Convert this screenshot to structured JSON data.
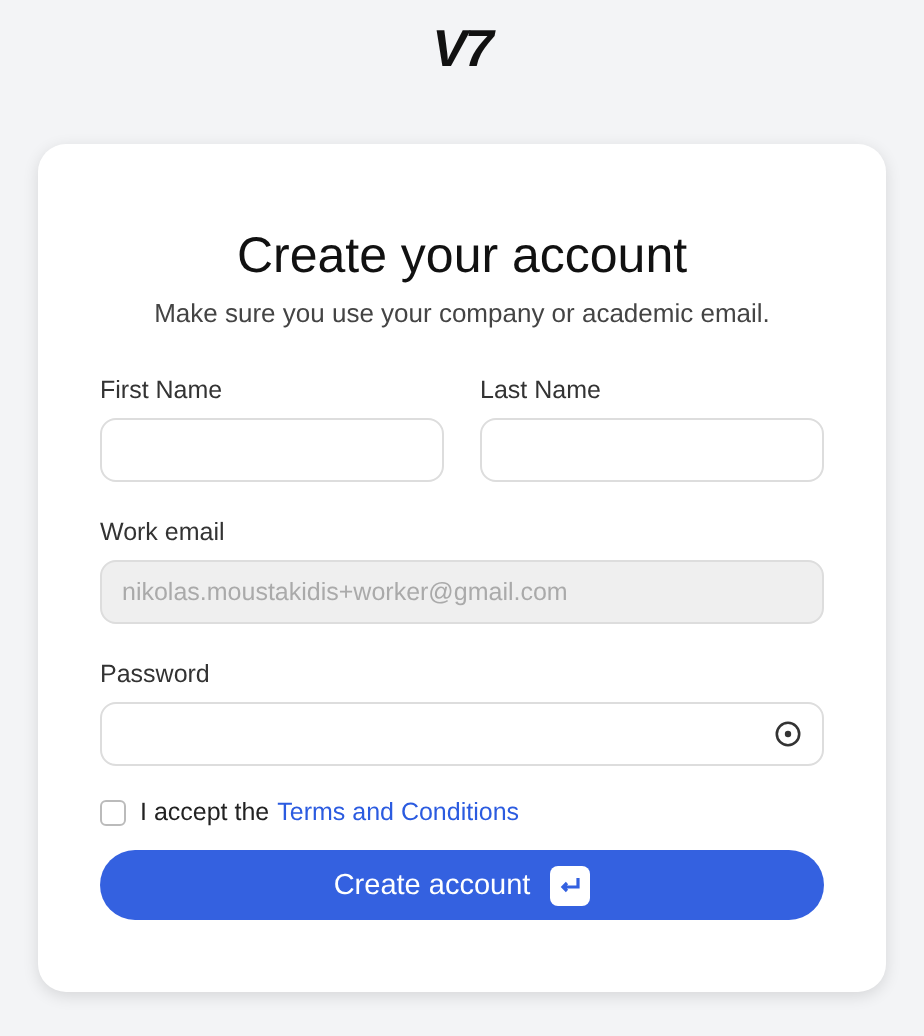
{
  "logo": "V7",
  "title": "Create your account",
  "subtitle": "Make sure you use your company or academic email.",
  "name_fields": [
    {
      "label": "First Name"
    },
    {
      "label": "Last Name"
    }
  ],
  "email": {
    "label": "Work email",
    "value": "nikolas.moustakidis+worker@gmail.com",
    "disabled": true
  },
  "password": {
    "label": "Password"
  },
  "terms": {
    "text": "I accept the",
    "link": "Terms and Conditions",
    "checked": false
  },
  "submit": {
    "label": "Create account"
  }
}
